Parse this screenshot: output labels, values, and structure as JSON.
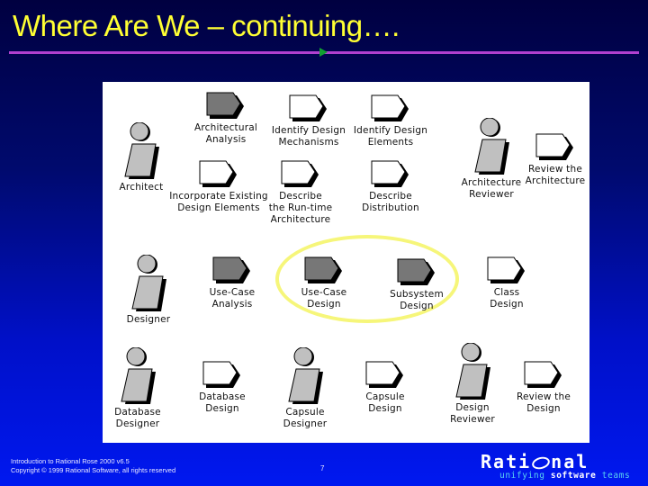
{
  "slide": {
    "title": "Where Are We – continuing….",
    "footer_line1": "Introduction to Rational Rose 2000 v6.5",
    "footer_line2": "Copyright © 1999 Rational Software, all rights reserved",
    "page_number": "7"
  },
  "logo": {
    "word_pre": "Rati",
    "word_post": "nal",
    "tag_1": "unifying",
    "tag_2": "software",
    "tag_3": "teams"
  },
  "colors": {
    "title": "#ffff33",
    "rule": "#b040d0",
    "highlight_ellipse": "#f6f67a",
    "activity_dark": "#777777",
    "activity_light": "#ffffff",
    "role_fill": "#c0c0c0"
  },
  "diagram": {
    "roles": [
      {
        "id": "architect",
        "label": "Architect"
      },
      {
        "id": "architecture-reviewer",
        "label": "Architecture\nReviewer"
      },
      {
        "id": "designer",
        "label": "Designer"
      },
      {
        "id": "database-designer",
        "label": "Database\nDesigner"
      },
      {
        "id": "capsule-designer",
        "label": "Capsule\nDesigner"
      },
      {
        "id": "design-reviewer",
        "label": "Design\nReviewer"
      }
    ],
    "activities": [
      {
        "id": "architectural-analysis",
        "label": "Architectural\nAnalysis",
        "style": "dark"
      },
      {
        "id": "identify-design-mechanisms",
        "label": "Identify Design\nMechanisms",
        "style": "light"
      },
      {
        "id": "identify-design-elements",
        "label": "Identify Design\nElements",
        "style": "light"
      },
      {
        "id": "review-the-architecture",
        "label": "Review the\nArchitecture",
        "style": "light"
      },
      {
        "id": "incorporate-existing-design-elements",
        "label": "Incorporate Existing\nDesign Elements",
        "style": "light"
      },
      {
        "id": "describe-runtime-architecture",
        "label": "Describe\nthe Run-time\nArchitecture",
        "style": "light"
      },
      {
        "id": "describe-distribution",
        "label": "Describe\nDistribution",
        "style": "light"
      },
      {
        "id": "use-case-analysis",
        "label": "Use-Case\nAnalysis",
        "style": "dark"
      },
      {
        "id": "use-case-design",
        "label": "Use-Case\nDesign",
        "style": "dark",
        "highlighted": true
      },
      {
        "id": "subsystem-design",
        "label": "Subsystem\nDesign",
        "style": "dark",
        "highlighted": true
      },
      {
        "id": "class-design",
        "label": "Class\nDesign",
        "style": "light"
      },
      {
        "id": "database-design",
        "label": "Database\nDesign",
        "style": "light"
      },
      {
        "id": "capsule-design",
        "label": "Capsule\nDesign",
        "style": "light"
      },
      {
        "id": "review-the-design",
        "label": "Review the\nDesign",
        "style": "light"
      }
    ]
  }
}
